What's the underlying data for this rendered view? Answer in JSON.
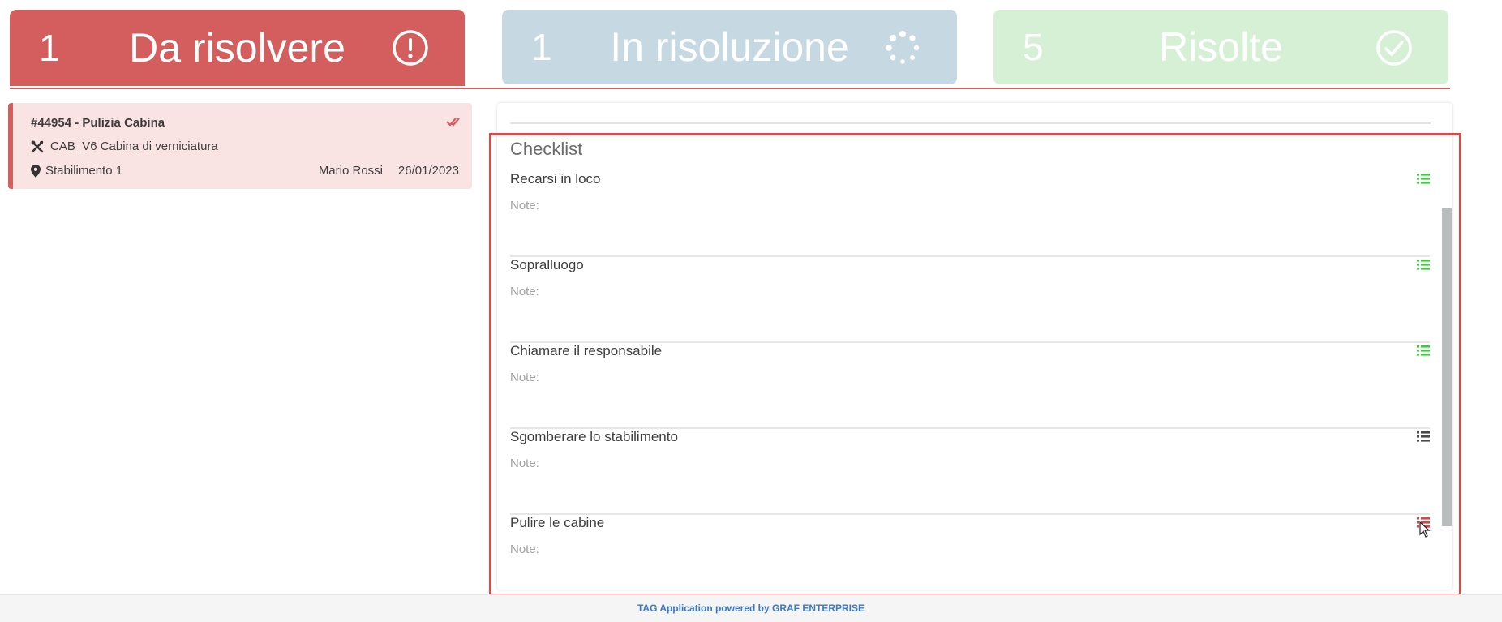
{
  "tabs": [
    {
      "count": "1",
      "label": "Da risolvere",
      "icon": "exclamation-circle-icon"
    },
    {
      "count": "1",
      "label": "In risoluzione",
      "icon": "spinner-icon"
    },
    {
      "count": "5",
      "label": "Risolte",
      "icon": "check-circle-icon"
    }
  ],
  "ticket": {
    "title": "#44954 - Pulizia Cabina",
    "asset": "CAB_V6 Cabina di verniciatura",
    "site": "Stabilimento 1",
    "user": "Mario Rossi",
    "date": "26/01/2023"
  },
  "checklist": {
    "title": "Checklist",
    "items": [
      {
        "name": "Recarsi in loco",
        "note": "Note:",
        "status_color": "#3ec93e"
      },
      {
        "name": "Sopralluogo",
        "note": "Note:",
        "status_color": "#3ec93e"
      },
      {
        "name": "Chiamare il responsabile",
        "note": "Note:",
        "status_color": "#3ec93e"
      },
      {
        "name": "Sgomberare lo stabilimento",
        "note": "Note:",
        "status_color": "#4a4a4a"
      },
      {
        "name": "Pulire le cabine",
        "note": "Note:",
        "status_color": "#d94444"
      }
    ]
  },
  "footer": {
    "text": "TAG Application powered by GRAF ENTERPRISE"
  },
  "colors": {
    "todo": "#d45d5d",
    "progress": "#c6d8e2",
    "done": "#d6f0d6"
  }
}
